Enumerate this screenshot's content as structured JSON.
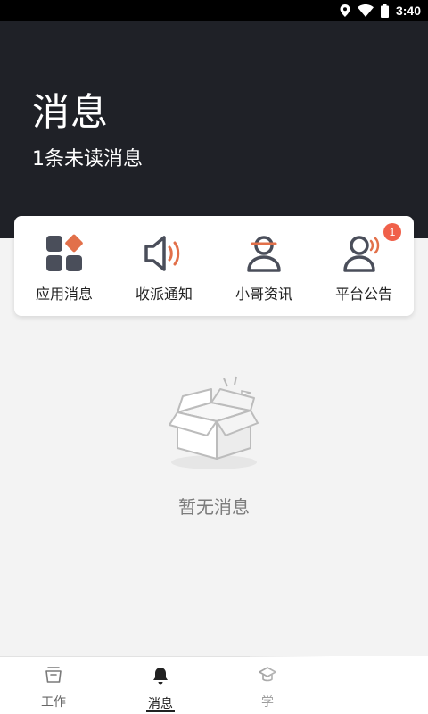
{
  "status_bar": {
    "time": "3:40",
    "icons": [
      "location-icon",
      "wifi-icon",
      "battery-icon"
    ]
  },
  "header": {
    "title": "消息",
    "subtitle": "1条未读消息"
  },
  "categories": [
    {
      "label": "应用消息",
      "icon": "apps-grid-icon"
    },
    {
      "label": "收派通知",
      "icon": "speaker-icon"
    },
    {
      "label": "小哥资讯",
      "icon": "courier-person-icon"
    },
    {
      "label": "平台公告",
      "icon": "announce-person-icon",
      "badge": "1"
    }
  ],
  "empty_state": {
    "icon": "empty-box-icon",
    "text": "暂无消息"
  },
  "bottom_nav": [
    {
      "label": "工作",
      "icon": "work-icon",
      "active": false
    },
    {
      "label": "消息",
      "icon": "bell-icon",
      "active": true
    },
    {
      "label": "学",
      "icon": "study-icon",
      "active": false
    }
  ],
  "colors": {
    "header_bg": "#1f2127",
    "accent": "#e2704a",
    "badge": "#f0604a",
    "icon_dark": "#4a4e5a"
  }
}
